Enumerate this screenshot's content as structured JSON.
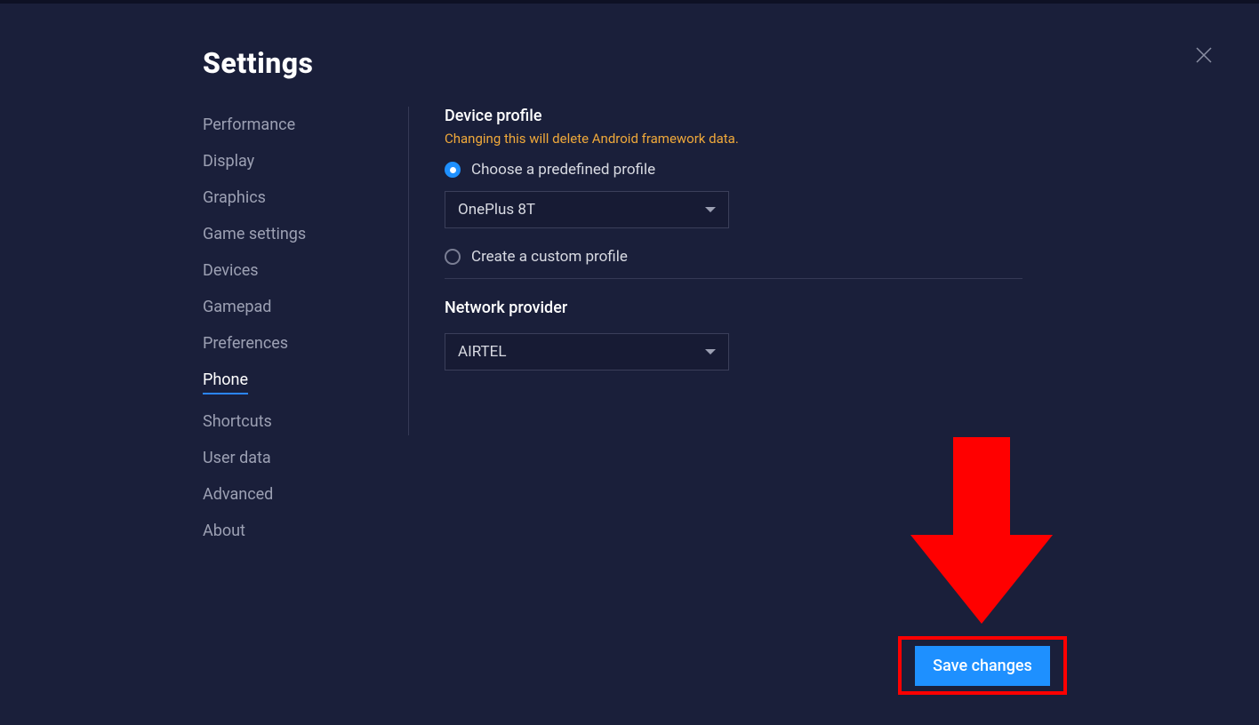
{
  "header": {
    "title": "Settings"
  },
  "sidebar": {
    "items": [
      {
        "label": "Performance"
      },
      {
        "label": "Display"
      },
      {
        "label": "Graphics"
      },
      {
        "label": "Game settings"
      },
      {
        "label": "Devices"
      },
      {
        "label": "Gamepad"
      },
      {
        "label": "Preferences"
      },
      {
        "label": "Phone"
      },
      {
        "label": "Shortcuts"
      },
      {
        "label": "User data"
      },
      {
        "label": "Advanced"
      },
      {
        "label": "About"
      }
    ],
    "active_index": 7
  },
  "main": {
    "device_profile": {
      "title": "Device profile",
      "warning": "Changing this will delete Android framework data.",
      "option_predefined_label": "Choose a predefined profile",
      "predefined_value": "OnePlus 8T",
      "option_custom_label": "Create a custom profile",
      "selected": "predefined"
    },
    "network_provider": {
      "title": "Network provider",
      "value": "AIRTEL"
    }
  },
  "footer": {
    "save_label": "Save changes"
  },
  "colors": {
    "background": "#1a1f3a",
    "accent": "#1e90ff",
    "warning": "#f0a93a",
    "highlight_border": "#ff0000"
  }
}
